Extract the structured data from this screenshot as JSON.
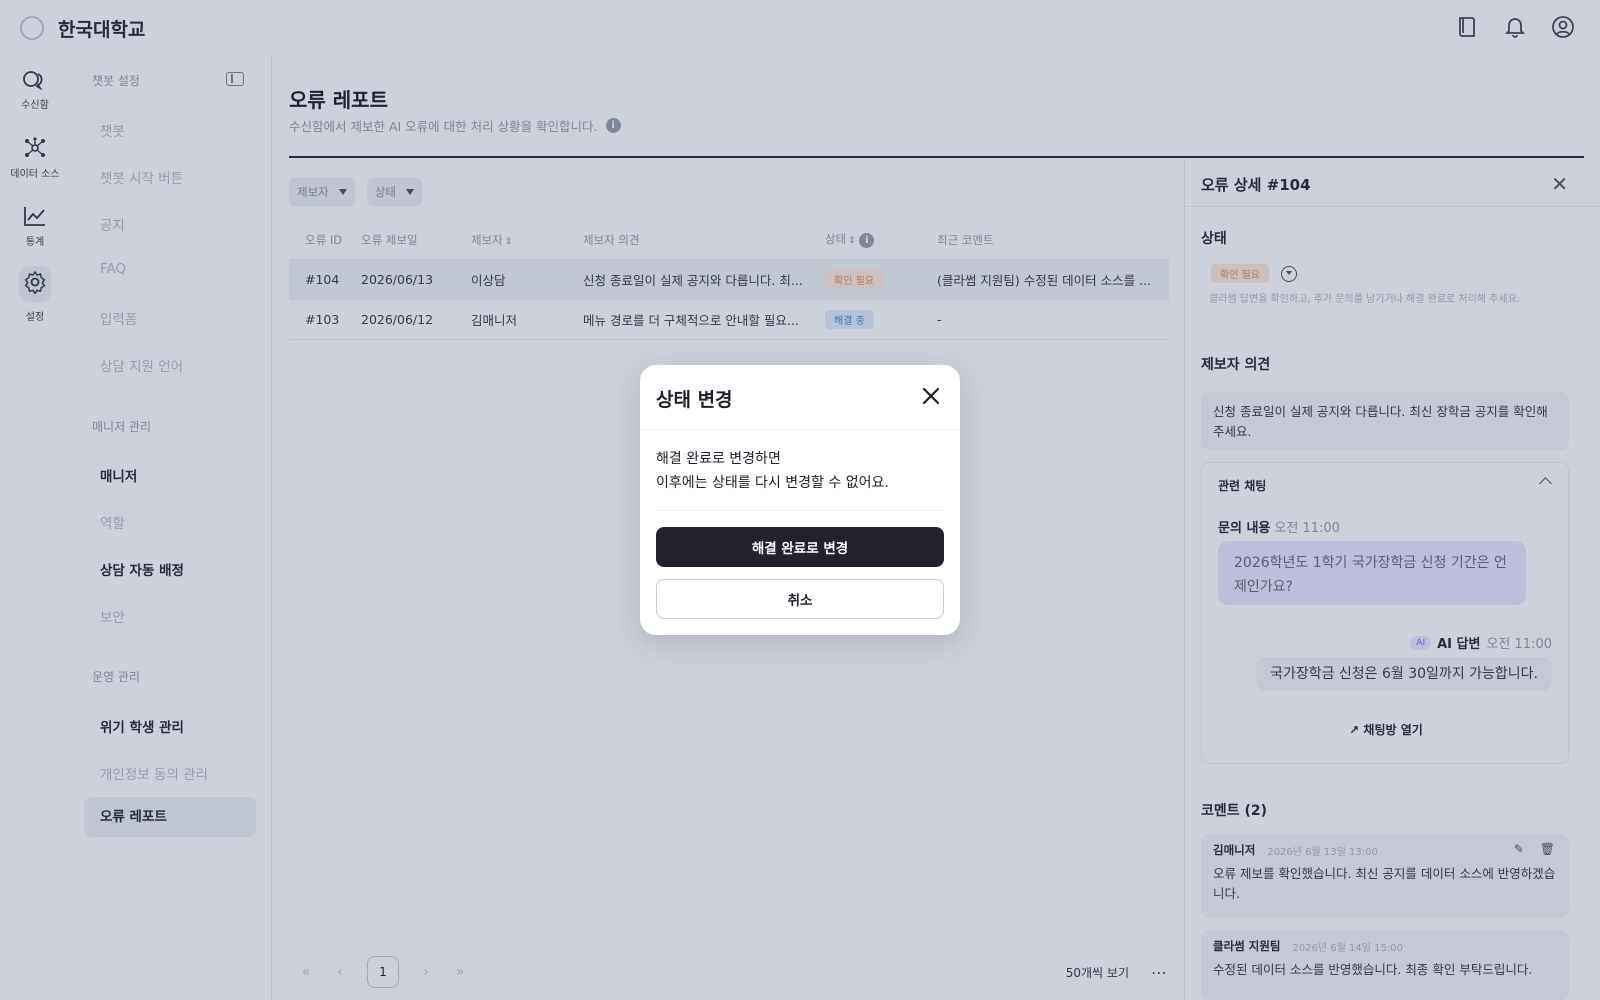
{
  "app": {
    "brand": "한국대학교"
  },
  "rail": [
    {
      "label": "수신함",
      "icon": "chat-bubbles-icon"
    },
    {
      "label": "데이터 소스",
      "icon": "network-icon"
    },
    {
      "label": "통계",
      "icon": "line-chart-icon"
    },
    {
      "label": "설정",
      "icon": "gear-icon"
    }
  ],
  "sidebar": {
    "header": "챗봇 설정",
    "chatbot_items": [
      "챗봇",
      "챗봇 시작 버튼",
      "공지",
      "FAQ",
      "입력폼",
      "상담 지원 언어"
    ],
    "manager_group": "매니저 관리",
    "manager_items": [
      "매니저",
      "역할",
      "상담 자동 배정",
      "보안"
    ],
    "ops_group": "운영 관리",
    "ops_items": [
      "위기 학생 관리",
      "개인정보 동의 관리",
      "오류 레포트"
    ]
  },
  "page": {
    "title": "오류 레포트",
    "description": "수신함에서 제보한 AI 오류에 대한 처리 상황을 확인합니다."
  },
  "filters": [
    "제보자",
    "상태"
  ],
  "table": {
    "headers": [
      "오류 ID",
      "오류 제보일",
      "제보자",
      "제보자 의견",
      "상태",
      "최근 코멘트"
    ],
    "rows": [
      {
        "id": "#104",
        "date": "2026/06/13",
        "reporter": "이상담",
        "opinion": "신청 종료일이 실제 공지와 다릅니다. 최...",
        "status": "확인 필요",
        "comment": "(클라썸 지원팀) 수정된 데이터 소스를 ..."
      },
      {
        "id": "#103",
        "date": "2026/06/12",
        "reporter": "김매니저",
        "opinion": "메뉴 경로를 더 구체적으로 안내할 필요...",
        "status": "해결 중",
        "comment": "-"
      }
    ]
  },
  "pagination": {
    "page": "1",
    "per_page": "50개씩 보기"
  },
  "detail": {
    "title": "오류 상세 #104",
    "status_label": "상태",
    "status_value": "확인 필요",
    "status_hint": "클라썸 답변을 확인하고, 추가 문의를 남기거나 해결 완료로 처리해 주세요.",
    "opinion_label": "제보자 의견",
    "opinion_text": "신청 종료일이 실제 공지와 다릅니다. 최신 장학금 공지를 확인해 주세요.",
    "chat_label": "관련 채팅",
    "question_label": "문의 내용",
    "question_time": "오전 11:00",
    "question_text": "2026학년도 1학기 국가장학금 신청 기간은 언제인가요?",
    "ai_badge": "AI",
    "answer_label": "AI 답변",
    "answer_time": "오전 11:00",
    "answer_text": "국가장학금 신청은 6월 30일까지 가능합니다.",
    "open_chat": "채팅방 열기",
    "comments_label": "코멘트 (2)",
    "comments": [
      {
        "author": "김매니저",
        "date": "2026년 6월 13일 13:00",
        "text": "오류 제보를 확인했습니다. 최신 공지를 데이터 소스에 반영하겠습니다."
      },
      {
        "author": "클라썸 지원팀",
        "date": "2026년 6월 14일 15:00",
        "text": "수정된 데이터 소스를 반영했습니다. 최종 확인 부탁드립니다."
      }
    ]
  },
  "modal": {
    "title": "상태 변경",
    "line1": "해결 완료로 변경하면",
    "line2": "이후에는 상태를 다시 변경할 수 없어요.",
    "confirm": "해결 완료로 변경",
    "cancel": "취소"
  },
  "colors": {
    "primary": "#22212e",
    "warning": "#e98a53",
    "progress": "#4a86dc",
    "overlay": "rgba(28,44,92,0.22)"
  }
}
